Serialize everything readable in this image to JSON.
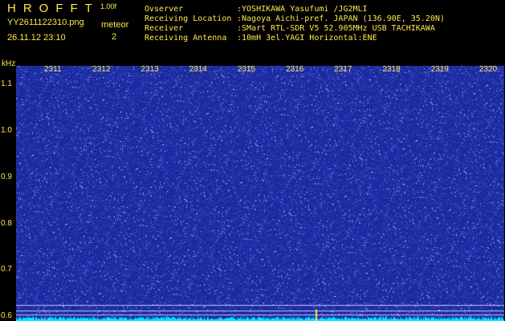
{
  "header": {
    "app_title": "HROFFT",
    "version": "1.00f",
    "file_name": "YY2611122310.png",
    "timestamp": "26.11.12 23:10",
    "mode_label": "meteor",
    "count_value": "2"
  },
  "station_info": [
    {
      "label": "Ovserver",
      "value": ":YOSHIKAWA Yasufumi /JG2MLI"
    },
    {
      "label": "Receiving Location",
      "value": ":Nagoya Aichi-pref. JAPAN (136.90E, 35.20N)"
    },
    {
      "label": "Receiver",
      "value": ":SMart RTL-SDR V5 52.905MHz USB TACHIKAWA"
    },
    {
      "label": "Receiving Antenna",
      "value": ":10mH 3el.YAGI Horizontal:ENE"
    }
  ],
  "spectrogram": {
    "freq_unit": "kHz",
    "time_ticks": [
      "2311",
      "2312",
      "2313",
      "2314",
      "2315",
      "2316",
      "2317",
      "2318",
      "2319",
      "2320"
    ],
    "freq_ticks": [
      "1.1",
      "1.0",
      "0.9",
      "0.8",
      "0.7",
      "0.6"
    ],
    "freq_tick_values": [
      1.1,
      1.0,
      0.9,
      0.8,
      0.7,
      0.6
    ],
    "freq_range": [
      0.59,
      1.14
    ],
    "reference_lines_khz": [
      0.625,
      0.613,
      0.603
    ],
    "detections": [
      {
        "time": "2316",
        "freq_khz": 0.6
      }
    ],
    "colors": {
      "background": "#1a2a9a",
      "noise": "#8fa0ff",
      "signal": "#ffe84a",
      "baseline": "#00e8ff",
      "ref_line": "#c0c0ff",
      "text": "#ffe84a"
    }
  }
}
